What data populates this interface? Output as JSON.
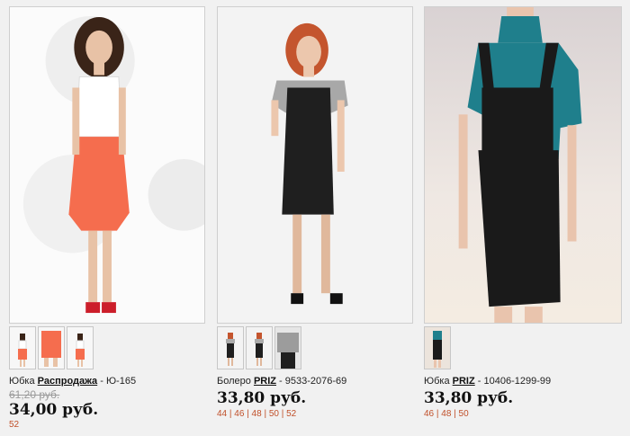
{
  "products": [
    {
      "title_prefix": "Юбка",
      "brand": "Распродажа",
      "article": " - Ю-165",
      "old_price": "61,20 руб.",
      "price": "34,00 руб.",
      "sizes": "52"
    },
    {
      "title_prefix": "Болеро",
      "brand": "PRIZ",
      "article": " - 9533-2076-69",
      "price": "33,80 руб.",
      "sizes": "44 | 46 | 48 | 50 | 52"
    },
    {
      "title_prefix": "Юбка",
      "brand": "PRIZ",
      "article": " - 10406-1299-99",
      "price": "33,80 руб.",
      "sizes": "46 | 48 | 50"
    }
  ]
}
